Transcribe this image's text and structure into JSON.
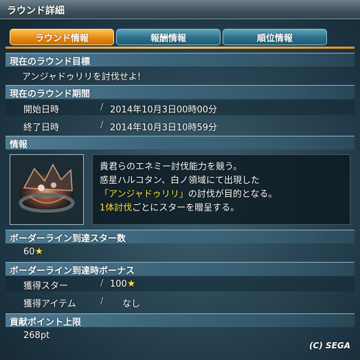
{
  "window": {
    "title": "ラウンド詳細"
  },
  "tabs": [
    {
      "label": "ラウンド情報",
      "active": true
    },
    {
      "label": "報酬情報",
      "active": false
    },
    {
      "label": "順位情報",
      "active": false
    }
  ],
  "goal": {
    "header": "現在のラウンド目標",
    "text": "アンジャドゥリリを討伐せよ!"
  },
  "period": {
    "header": "現在のラウンド期間",
    "start_label": "開始日時",
    "start_value": "2014年10月3日00時00分",
    "end_label": "終了日時",
    "end_value": "2014年10月3日10時59分"
  },
  "info": {
    "header": "情報",
    "line1": "貴君らのエネミー討伐能力を競う。",
    "line2": "惑星ハルコタン、白ノ領域にて出現した",
    "line3_highlight": "「アンジャドゥリリ」",
    "line3_rest": "の討伐が目的となる。",
    "line4_highlight": "1体討伐",
    "line4_rest": "ごとにスターを贈呈する。"
  },
  "borderline": {
    "header": "ボーダーライン到達スター数",
    "value": "60"
  },
  "bonus": {
    "header": "ボーダーライン到達時ボーナス",
    "star_label": "獲得スター",
    "star_value": "100",
    "item_label": "獲得アイテム",
    "item_value": "なし"
  },
  "contribution": {
    "header": "貢献ポイント上限",
    "value": "268pt"
  },
  "copyright": "(C)  SEGA",
  "colors": {
    "tab_active": "#e88a15",
    "tab_inactive": "#2d6f8a",
    "highlight": "#ffe24a",
    "section": "#4f7b93"
  },
  "icons": {
    "star": "star-icon"
  }
}
